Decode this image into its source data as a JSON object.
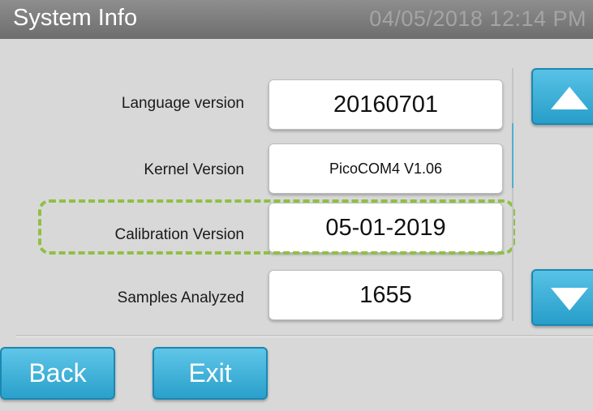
{
  "header": {
    "title": "System Info",
    "datetime": "04/05/2018 12:14 PM"
  },
  "rows": [
    {
      "label": "Language version",
      "value": "20160701"
    },
    {
      "label": "Kernel Version",
      "value": "PicoCOM4 V1.06"
    },
    {
      "label": "Calibration Version",
      "value": "05-01-2019"
    },
    {
      "label": "Samples Analyzed",
      "value": "1655"
    }
  ],
  "highlight": {
    "row": "Calibration Version",
    "color": "#8fc043"
  },
  "buttons": {
    "back": "Back",
    "exit": "Exit",
    "scroll_up_icon": "triangle-up-icon",
    "scroll_down_icon": "triangle-down-icon"
  },
  "colors": {
    "accent": "#36b0dc",
    "titlebar": "#7a7a7a",
    "background": "#d8d8d8"
  }
}
